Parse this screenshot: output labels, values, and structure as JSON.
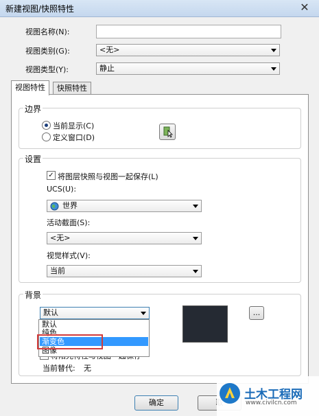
{
  "window": {
    "title": "新建视图/快照特性",
    "close_glyph": "✕"
  },
  "form": {
    "view_name_label": "视图名称(N):",
    "view_name_value": "",
    "view_category_label": "视图类别(G):",
    "view_category_value": "<无>",
    "view_type_label": "视图类型(Y):",
    "view_type_value": "静止"
  },
  "tabs": [
    {
      "label": "视图特性",
      "active": true
    },
    {
      "label": "快照特性",
      "active": false
    }
  ],
  "boundary": {
    "title": "边界",
    "current_display": "当前显示(C)",
    "define_window": "定义窗口(D)",
    "selected": "current_display"
  },
  "settings": {
    "title": "设置",
    "save_layer_snapshot": "将图层快照与视图一起保存(L)",
    "save_layer_checked": true,
    "ucs_label": "UCS(U):",
    "ucs_value": "世界",
    "section_label": "活动截面(S):",
    "section_value": "<无>",
    "visual_style_label": "视觉样式(V):",
    "visual_style_value": "当前"
  },
  "background": {
    "title": "背景",
    "selected_value": "默认",
    "options": [
      "默认",
      "纯色",
      "渐变色",
      "图像"
    ],
    "highlighted_option": "渐变色",
    "ellipsis_label": "...",
    "partial_checkbox_text": "将阳光特性与视图一起保存",
    "current_override_label": "当前替代:",
    "current_override_value": "无",
    "preview_color": "#252a33"
  },
  "buttons": {
    "ok": "确定",
    "cancel": "取"
  },
  "watermark": {
    "text": "土木工程网",
    "url": "www.civilcn.com"
  },
  "colors": {
    "highlight": "#3399ff",
    "red_box": "#d23b3b",
    "accent": "#1b3d7b"
  }
}
